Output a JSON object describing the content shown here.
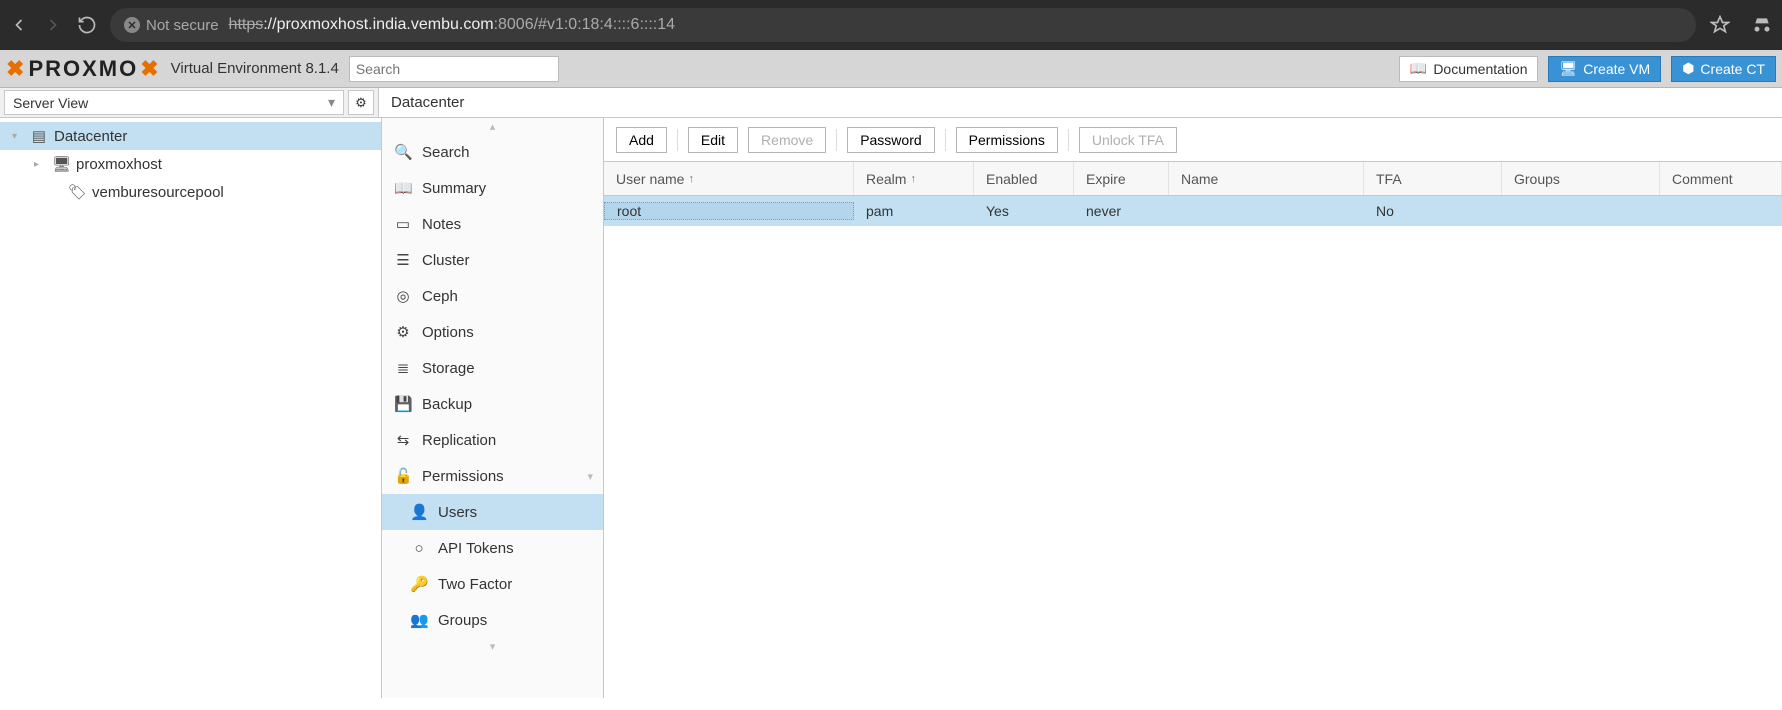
{
  "browser": {
    "not_secure": "Not secure",
    "url_scheme": "https",
    "url_host": "://proxmoxhost.india.vembu.com",
    "url_port_path": ":8006/#v1:0:18:4::::6::::14"
  },
  "header": {
    "logo_text": "PROXMO",
    "version": "Virtual Environment 8.1.4",
    "search_placeholder": "Search",
    "btn_doc": "Documentation",
    "btn_vm": "Create VM",
    "btn_ct": "Create CT"
  },
  "subheader": {
    "view": "Server View",
    "crumb": "Datacenter"
  },
  "tree": {
    "items": [
      {
        "label": "Datacenter",
        "glyph": "▤",
        "expander": "▾",
        "selected": true,
        "indent": 0
      },
      {
        "label": "proxmoxhost",
        "glyph": "🖥",
        "expander": "▸",
        "selected": false,
        "indent": 1
      },
      {
        "label": "vemburesourcepool",
        "glyph": "🏷",
        "expander": "",
        "selected": false,
        "indent": 2
      }
    ]
  },
  "nav": {
    "items": [
      {
        "label": "Search",
        "icon": "🔍",
        "sub": false
      },
      {
        "label": "Summary",
        "icon": "📖",
        "sub": false
      },
      {
        "label": "Notes",
        "icon": "▭",
        "sub": false
      },
      {
        "label": "Cluster",
        "icon": "☰",
        "sub": false
      },
      {
        "label": "Ceph",
        "icon": "◎",
        "sub": false
      },
      {
        "label": "Options",
        "icon": "⚙",
        "sub": false
      },
      {
        "label": "Storage",
        "icon": "≣",
        "sub": false
      },
      {
        "label": "Backup",
        "icon": "💾",
        "sub": false
      },
      {
        "label": "Replication",
        "icon": "⇆",
        "sub": false
      },
      {
        "label": "Permissions",
        "icon": "🔓",
        "sub": false,
        "expandable": true
      },
      {
        "label": "Users",
        "icon": "👤",
        "sub": true,
        "selected": true
      },
      {
        "label": "API Tokens",
        "icon": "○",
        "sub": true
      },
      {
        "label": "Two Factor",
        "icon": "🔑",
        "sub": true
      },
      {
        "label": "Groups",
        "icon": "👥",
        "sub": true
      }
    ]
  },
  "toolbar": {
    "add": "Add",
    "edit": "Edit",
    "remove": "Remove",
    "password": "Password",
    "permissions": "Permissions",
    "unlock": "Unlock TFA"
  },
  "grid": {
    "headers": {
      "user": "User name",
      "realm": "Realm",
      "enabled": "Enabled",
      "expire": "Expire",
      "name": "Name",
      "tfa": "TFA",
      "groups": "Groups",
      "comment": "Comment"
    },
    "rows": [
      {
        "user": "root",
        "realm": "pam",
        "enabled": "Yes",
        "expire": "never",
        "name": "",
        "tfa": "No",
        "groups": "",
        "comment": ""
      }
    ]
  }
}
